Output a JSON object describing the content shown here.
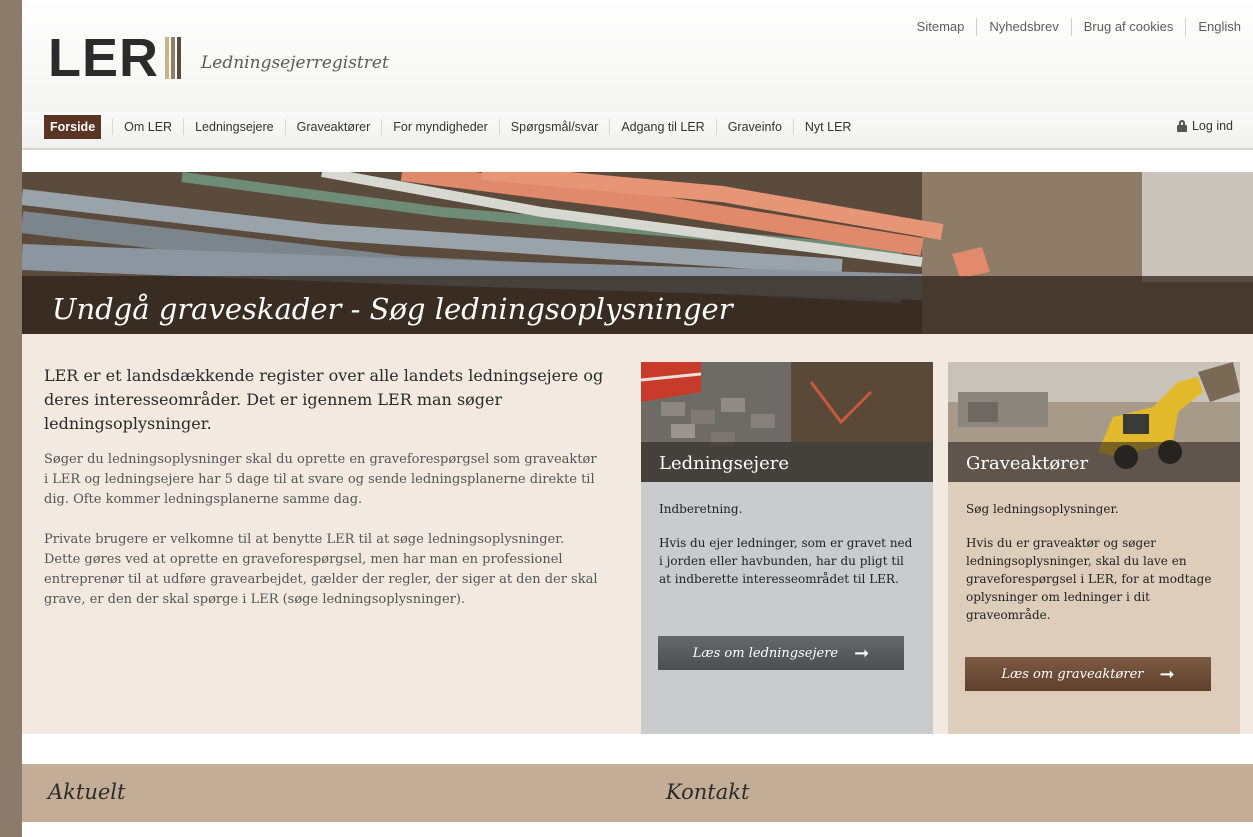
{
  "brand": {
    "logo_text": "LER",
    "tagline": "Ledningsejerregistret",
    "bar_colors": [
      "#c8b48a",
      "#8f7e6a",
      "#5a4d40"
    ]
  },
  "top_links": [
    "Sitemap",
    "Nyhedsbrev",
    "Brug af cookies",
    "English"
  ],
  "nav": {
    "items": [
      "Forside",
      "Om LER",
      "Ledningsejere",
      "Graveaktører",
      "For myndigheder",
      "Spørgsmål/svar",
      "Adgang til LER",
      "Graveinfo",
      "Nyt LER"
    ],
    "active": "Forside",
    "login": "Log ind"
  },
  "hero": {
    "title": "Undgå graveskader - Søg ledningsoplysninger"
  },
  "intro": {
    "lead": "LER er et landsdækkende register over alle landets ledningsejere og deres interesseområder. Det er igennem LER man søger ledningsoplysninger.",
    "p1": "Søger du ledningsoplysninger skal du oprette en graveforespørgsel som graveaktør i LER og ledningsejere har 5 dage til at svare og sende ledningsplanerne direkte til dig. Ofte kommer ledningsplanerne samme dag.",
    "p2": "Private brugere er velkomne til at benytte LER til at søge ledningsoplysninger. Dette gøres ved at oprette en graveforespørgsel, men har man en professionel entreprenør til at udføre gravearbejdet, gælder der regler, der siger at den der skal grave, er den der skal spørge i LER (søge ledningsoplysninger)."
  },
  "cards": [
    {
      "title": "Ledningsejere",
      "subtitle": "Indberetning.",
      "text": "Hvis du ejer ledninger, som er gravet ned i jorden eller havbunden, har du pligt til at indberette interesseområdet til LER.",
      "button": "Læs om ledningsejere"
    },
    {
      "title": "Graveaktører",
      "subtitle": "Søg ledningsoplysninger.",
      "text": "Hvis du er graveaktør og søger ledningsoplysninger, skal du lave en graveforespørgsel i LER, for at modtage oplysninger om ledninger i dit graveområde.",
      "button": "Læs om graveaktører"
    }
  ],
  "footer": {
    "left_title": "Aktuelt",
    "right_title": "Kontakt"
  },
  "colors": {
    "active_nav": "#5a3524",
    "main_bg": "#f2e9e0",
    "card_gray": "#c9cbcd",
    "card_beige": "#dfcdbb",
    "footer_bar": "#c4ad97"
  }
}
